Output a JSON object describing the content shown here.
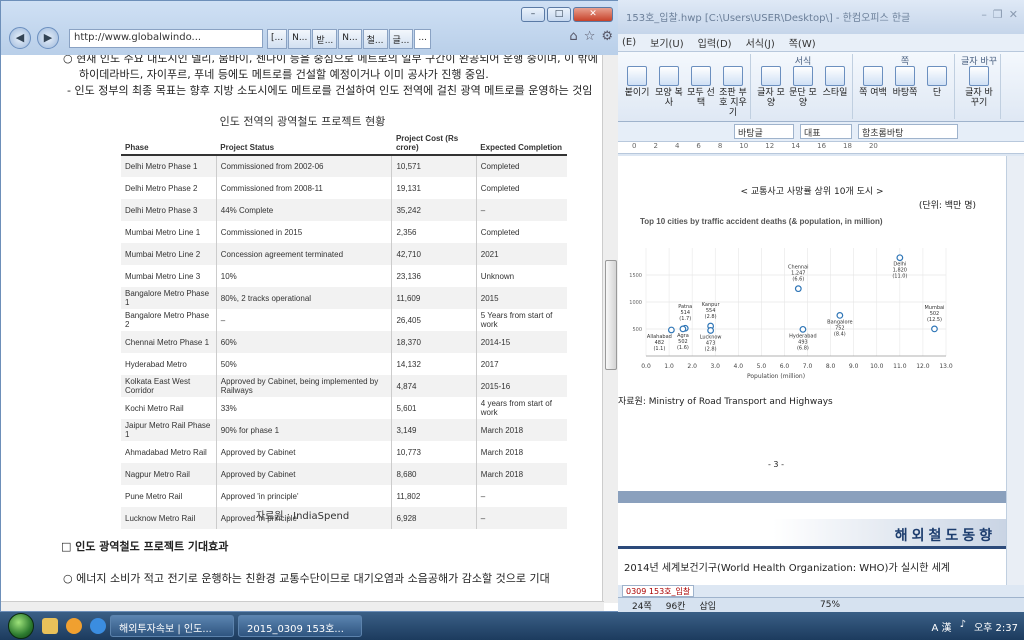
{
  "ie": {
    "address": "http://www.globalwindo...",
    "tabs": [
      "[...",
      "N...",
      "받...",
      "N...",
      "철...",
      "글...",
      "..."
    ],
    "paragraphs": [
      "○ 현재 인도 주요 대도시인 델리, 뭄바이, 첸나이 등을 중심으로 메트로의 일부 구간이 완공되어 운행 중이며, 이 밖에",
      "하이데라바드, 자이푸르, 푸네 등에도 메트로를 건설할 예정이거나 이미 공사가 진행 중임.",
      "- 인도 정부의 최종 목표는 향후 지방 소도시에도 메트로를 건설하여 인도 전역에 걸친 광역 메트로를 운영하는 것임"
    ],
    "table_title": "인도 전역의 광역철도 프로젝트 현황",
    "table": {
      "headers": [
        "Phase",
        "Project Status",
        "Project Cost (Rs crore)",
        "Expected Completion"
      ],
      "rows": [
        [
          "Delhi Metro Phase 1",
          "Commissioned from 2002-06",
          "10,571",
          "Completed"
        ],
        [
          "Delhi Metro Phase 2",
          "Commissioned from 2008-11",
          "19,131",
          "Completed"
        ],
        [
          "Delhi Metro Phase 3",
          "44% Complete",
          "35,242",
          "–"
        ],
        [
          "Mumbai Metro Line 1",
          "Commissioned in 2015",
          "2,356",
          "Completed"
        ],
        [
          "Mumbai Metro Line 2",
          "Concession agreement terminated",
          "42,710",
          "2021"
        ],
        [
          "Mumbai Metro Line 3",
          "10%",
          "23,136",
          "Unknown"
        ],
        [
          "Bangalore Metro Phase 1",
          "80%, 2 tracks operational",
          "11,609",
          "2015"
        ],
        [
          "Bangalore Metro Phase 2",
          "–",
          "26,405",
          "5 Years from start of work"
        ],
        [
          "Chennai Metro Phase 1",
          "60%",
          "18,370",
          "2014-15"
        ],
        [
          "Hyderabad Metro",
          "50%",
          "14,132",
          "2017"
        ],
        [
          "Kolkata East West Corridor",
          "Approved by Cabinet, being implemented by Railways",
          "4,874",
          "2015-16"
        ],
        [
          "Kochi Metro Rail",
          "33%",
          "5,601",
          "4 years from start of work"
        ],
        [
          "Jaipur Metro Rail Phase 1",
          "90% for phase 1",
          "3,149",
          "March 2018"
        ],
        [
          "Ahmadabad Metro Rail",
          "Approved by Cabinet",
          "10,773",
          "March 2018"
        ],
        [
          "Nagpur Metro Rail",
          "Approved by Cabinet",
          "8,680",
          "March 2018"
        ],
        [
          "Pune Metro Rail",
          "Approved 'in principle'",
          "11,802",
          "–"
        ],
        [
          "Lucknow Metro Rail",
          "Approved 'in principle'",
          "6,928",
          "–"
        ]
      ]
    },
    "source": "자료원 : IndiaSpend",
    "section": "□ 인도 광역철도 프로젝트 기대효과",
    "bottom_text": "○ 에너지 소비가 적고 전기로 운행하는 친환경 교통수단이므로 대기오염과 소음공해가 감소할 것으로 기대"
  },
  "hwp": {
    "title": "153호_입찰.hwp [C:\\Users\\USER\\Desktop\\] - 한컴오피스 한글",
    "menu": [
      "(E)",
      "보기(U)",
      "입력(D)",
      "서식(J)",
      "쪽(W)"
    ],
    "ribbon_groups": [
      {
        "title": "",
        "buttons": [
          "붙이기",
          "모양 복사",
          "모두 선택",
          "조판 부호 지우기"
        ]
      },
      {
        "title": "서식",
        "buttons": [
          "글자 모양",
          "문단 모양",
          "스타일"
        ]
      },
      {
        "title": "쪽",
        "buttons": [
          "쪽 여백",
          "바탕쪽",
          "단"
        ]
      },
      {
        "title": "글자 바꾸",
        "buttons": [
          "글자 바꾸기"
        ]
      }
    ],
    "combos": [
      "바탕글",
      "대표",
      "함초롬바탕"
    ],
    "chart_caption": "< 교통사고 사망률 상위 10개 도시 >",
    "chart_unit": "(단위: 백만 명)",
    "source": "자료원: Ministry of Road Transport and Highways",
    "page_number": "- 3 -",
    "banner": "해외철도동향",
    "body": "2014년 세계보건기구(World Health Organization: WHO)가 실시한 세계",
    "doc_tab": "0309 153호_입찰",
    "status": [
      "24쪽",
      "96칸",
      "삽입"
    ],
    "zoom": "75%"
  },
  "chart_data": {
    "type": "scatter",
    "title": "Top 10 cities by traffic accident deaths (& population, in million)",
    "xlabel": "Population (million)",
    "ylabel": "",
    "xlim": [
      0,
      13
    ],
    "ylim": [
      0,
      2000
    ],
    "x_ticks": [
      "0.0",
      "1.0",
      "2.0",
      "3.0",
      "4.0",
      "5.0",
      "6.0",
      "7.0",
      "8.0",
      "9.0",
      "10.0",
      "11.0",
      "12.0",
      "13.0"
    ],
    "y_ticks": [
      "500",
      "1000",
      "1500"
    ],
    "points": [
      {
        "city": "Allahabad",
        "deaths": 482,
        "pop": 1.1
      },
      {
        "city": "Patna",
        "deaths": 514,
        "pop": 1.7
      },
      {
        "city": "Agra",
        "deaths": 502,
        "pop": 1.6
      },
      {
        "city": "Kanpur",
        "deaths": 554,
        "pop": 2.8
      },
      {
        "city": "Lucknow",
        "deaths": 473,
        "pop": 2.8
      },
      {
        "city": "Chennai",
        "deaths": 1247,
        "pop": 6.6
      },
      {
        "city": "Hyderabad",
        "deaths": 493,
        "pop": 6.8
      },
      {
        "city": "Bangalore",
        "deaths": 752,
        "pop": 8.4
      },
      {
        "city": "Delhi",
        "deaths": 1820,
        "pop": 11.0
      },
      {
        "city": "Mumbai",
        "deaths": 502,
        "pop": 12.5
      }
    ],
    "color": "#2e75b6"
  },
  "taskbar": {
    "tasks": [
      "해외투자속보 | 인도...",
      "2015_0309 153호..."
    ],
    "clock": "오후 2:37"
  }
}
